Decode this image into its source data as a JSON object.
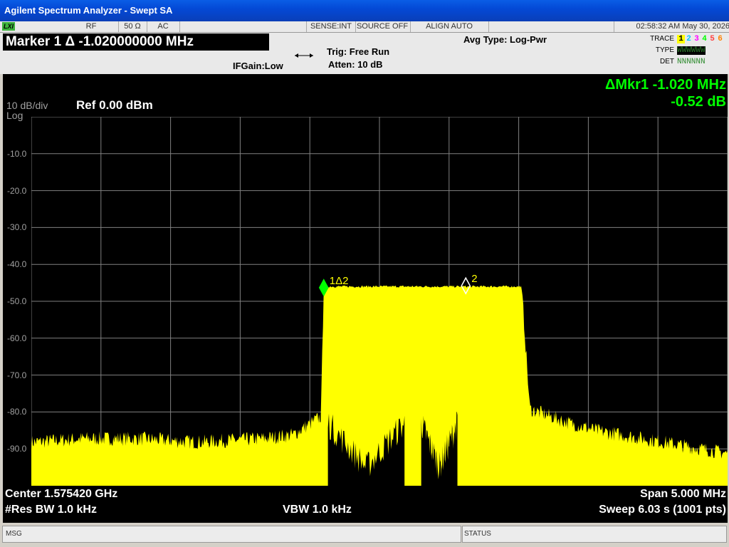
{
  "window": {
    "title": "Agilent Spectrum Analyzer - Swept SA"
  },
  "status_row": {
    "lxi": "LXI",
    "rf": "RF",
    "impedance": "50 Ω",
    "coupling": "AC",
    "sense": "SENSE:INT",
    "source": "SOURCE OFF",
    "align": "ALIGN AUTO",
    "datetime": "02:58:32 AM May 30, 2026"
  },
  "header": {
    "marker_title": "Marker 1 Δ -1.020000000 MHz",
    "ifgain": "IFGain:Low",
    "trig": "Trig: Free Run",
    "atten": "Atten: 10 dB",
    "avg_type": "Avg Type: Log-Pwr",
    "trace_label": "TRACE",
    "type_label": "TYPE",
    "det_label": "DET",
    "trace_numbers": [
      "1",
      "2",
      "3",
      "4",
      "5",
      "6"
    ],
    "trace_colors": [
      "#ffff00",
      "#00c8ff",
      "#ff00ff",
      "#00ff00",
      "#ff4040",
      "#ff8000"
    ],
    "type_values": "WWWWWW",
    "det_values": "NNNNNN"
  },
  "screen": {
    "scale": "10 dB/div",
    "log": "Log",
    "ref": "Ref 0.00 dBm",
    "delta_marker_freq": "ΔMkr1 -1.020 MHz",
    "delta_marker_amp": "-0.52 dB",
    "y_labels": [
      "-10.0",
      "-20.0",
      "-30.0",
      "-40.0",
      "-50.0",
      "-60.0",
      "-70.0",
      "-80.0",
      "-90.0"
    ],
    "marker1_label": "1Δ2",
    "marker2_label": "2",
    "center": "Center 1.575420 GHz",
    "res_bw": "#Res BW 1.0 kHz",
    "vbw": "VBW 1.0 kHz",
    "span": "Span 5.000 MHz",
    "sweep": "Sweep  6.03 s (1001 pts)"
  },
  "bottom": {
    "msg": "MSG",
    "status": "STATUS"
  },
  "colors": {
    "trace": "#ffff00",
    "marker_active": "#00ff00",
    "grid": "#808080"
  },
  "chart_data": {
    "type": "area",
    "x_unit": "GHz",
    "ylabel": "",
    "ylim": [
      -100,
      0
    ],
    "xlim": [
      1.57292,
      1.57792
    ],
    "grid": true,
    "series": [
      {
        "x": [
          1.57292,
          1.5733,
          1.5737,
          1.5741,
          1.57458,
          1.5748,
          1.575,
          1.57502,
          1.5752,
          1.5754,
          1.57544,
          1.5757,
          1.5759,
          1.57605,
          1.5762,
          1.57644,
          1.5765,
          1.5768,
          1.577,
          1.57792
        ],
        "y": [
          -89,
          -88,
          -88,
          -89,
          -88,
          -87,
          -82,
          -46,
          -46,
          -46,
          -46,
          -46,
          -46,
          -46,
          -46,
          -46,
          -80,
          -84,
          -86,
          -92
        ]
      }
    ],
    "markers": [
      {
        "label": "1Δ2",
        "x": 1.57502,
        "y": -46.3
      },
      {
        "label": "2",
        "x": 1.57604,
        "y": -45.8
      }
    ]
  }
}
